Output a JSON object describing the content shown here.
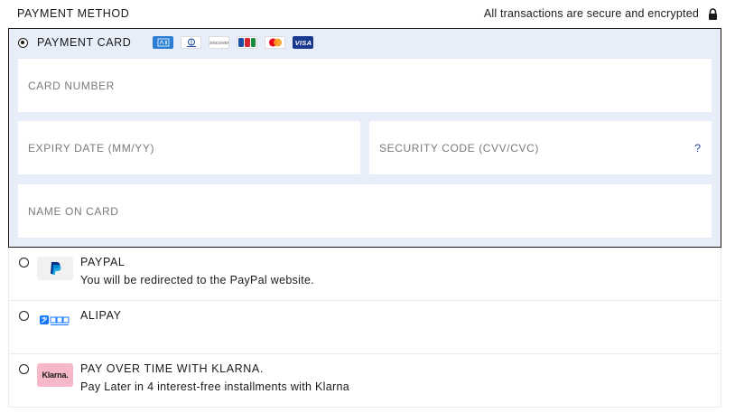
{
  "header": {
    "title": "PAYMENT METHOD",
    "secure_text": "All transactions are secure and encrypted"
  },
  "payment_card": {
    "label": "PAYMENT CARD",
    "brands": {
      "discover": "DISCOVER",
      "visa": "VISA"
    },
    "card_number_placeholder": "CARD NUMBER",
    "expiry_placeholder": "EXPIRY DATE (MM/YY)",
    "cvv_placeholder": "SECURITY CODE (CVV/CVC)",
    "cvv_help": "?",
    "name_placeholder": "NAME ON CARD"
  },
  "options": {
    "paypal": {
      "title": "PAYPAL",
      "desc": "You will be redirected to the PayPal website."
    },
    "alipay": {
      "title": "ALIPAY"
    },
    "klarna": {
      "title": "PAY OVER TIME WITH KLARNA.",
      "desc": "Pay Later in 4 interest-free installments with Klarna",
      "logo_text": "Klarna."
    }
  },
  "colors": {
    "selected_bg": "#e8eef9",
    "accent": "#2143a8",
    "klarna_pink": "#f6b8c8",
    "paypal_blue": "#003087"
  }
}
